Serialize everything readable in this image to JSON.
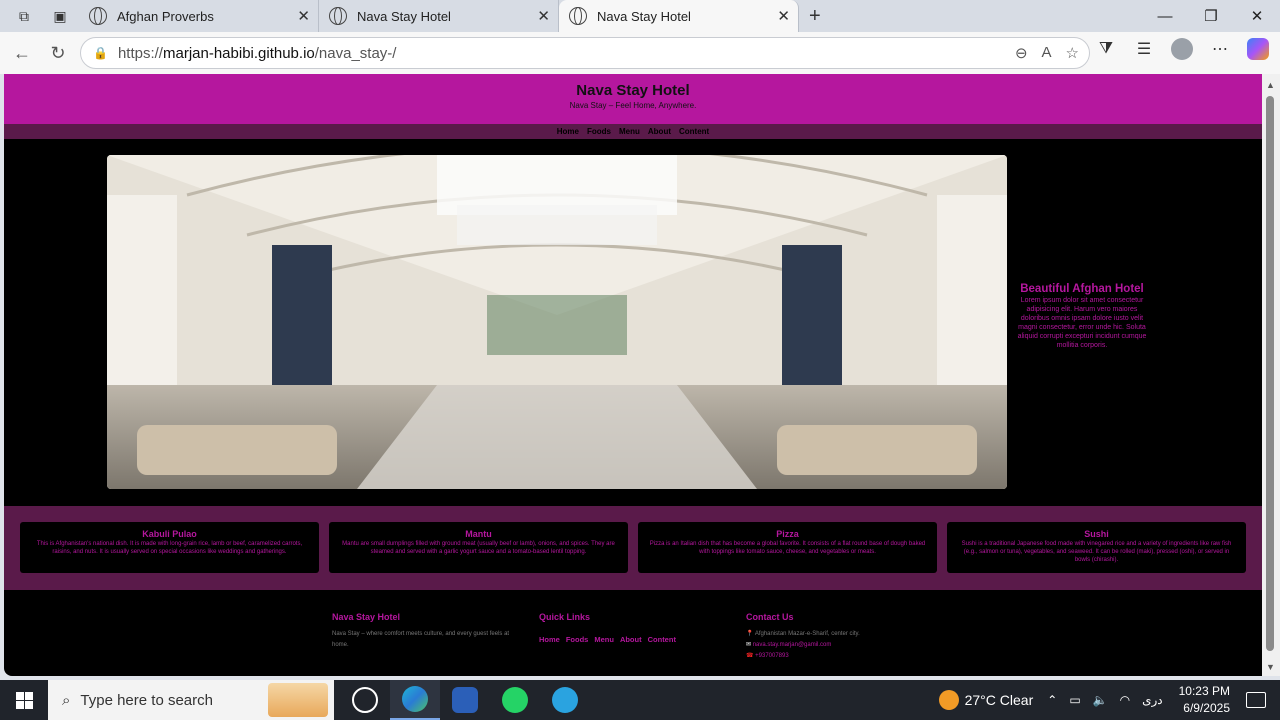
{
  "browser": {
    "tabs": [
      {
        "title": "Afghan Proverbs",
        "active": false
      },
      {
        "title": "Nava Stay Hotel",
        "active": false
      },
      {
        "title": "Nava Stay Hotel",
        "active": true
      }
    ],
    "url_prefix": "https://",
    "url_host": "marjan-habibi.github.io",
    "url_path": "/nava_stay-/"
  },
  "site": {
    "title": "Nava Stay Hotel",
    "tagline": "Nava Stay – Feel Home, Anywhere.",
    "nav": [
      "Home",
      "Foods",
      "Menu",
      "About",
      "Content"
    ],
    "hero": {
      "heading": "Beautiful Afghan Hotel",
      "text": "Lorem ipsum dolor sit amet consectetur adipisicing elit. Harum vero maiores doloribus omnis ipsam dolore iusto velit magni consectetur, error unde hic. Soluta aliquid corrupti excepturi incidunt cumque mollitia corporis."
    },
    "foods": [
      {
        "name": "Kabuli Pulao",
        "desc": "This is Afghanistan's national dish. It is made with long-grain rice, lamb or beef, caramelized carrots, raisins, and nuts. It is usually served on special occasions like weddings and gatherings."
      },
      {
        "name": "Mantu",
        "desc": "Mantu are small dumplings filled with ground meat (usually beef or lamb), onions, and spices. They are steamed and served with a garlic yogurt sauce and a tomato-based lentil topping."
      },
      {
        "name": "Pizza",
        "desc": "Pizza is an Italian dish that has become a global favorite. It consists of a flat round base of dough baked with toppings like tomato sauce, cheese, and vegetables or meats."
      },
      {
        "name": "Sushi",
        "desc": "Sushi is a traditional Japanese food made with vinegared rice and a variety of ingredients like raw fish (e.g., salmon or tuna), vegetables, and seaweed. It can be rolled (maki), pressed (oshi), or served in bowls (chirashi)."
      }
    ],
    "footer": {
      "about_title": "Nava Stay Hotel",
      "about_text": "Nava Stay – where comfort meets culture, and every guest feels at home.",
      "links_title": "Quick Links",
      "links": [
        "Home",
        "Foods",
        "Menu",
        "About",
        "Content"
      ],
      "contact_title": "Contact Us",
      "address": "Afghanistan Mazar-e-Sharif, center city.",
      "email": "nava.stay.marjan@gamil.com",
      "phone": "+937007893"
    }
  },
  "taskbar": {
    "search_placeholder": "Type here to search",
    "weather": "27°C  Clear",
    "lang": "دری",
    "time": "10:23 PM",
    "date": "6/9/2025"
  },
  "colors": {
    "accent": "#b5179e",
    "dark_band": "#5a1a4a"
  }
}
